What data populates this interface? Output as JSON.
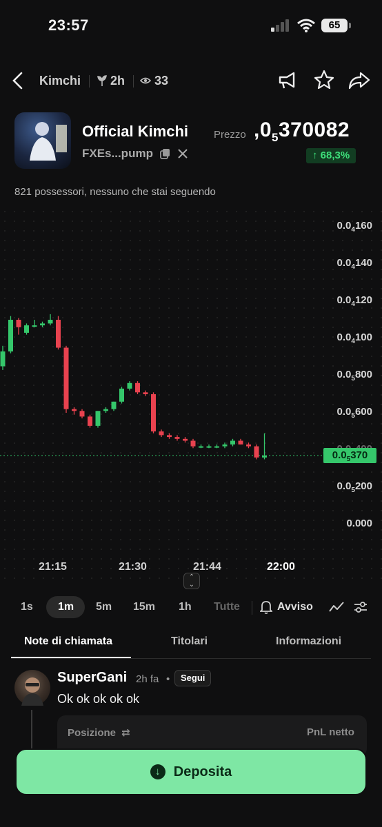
{
  "status_bar": {
    "time": "23:57",
    "battery": "65"
  },
  "header": {
    "name": "Kimchi",
    "age": "2h",
    "viewers": "33"
  },
  "token": {
    "name": "Official Kimchi",
    "address": "FXEs...pump",
    "price_label": "Prezzo",
    "price_prefix": ",0",
    "price_sub": "5",
    "price_digits": "370082",
    "change": "↑ 68,3%",
    "holders_text": "821 possessori, nessuno che stai seguendo"
  },
  "chart": {
    "y_labels": [
      {
        "lead": "0.0",
        "sub": "4",
        "tail": "160"
      },
      {
        "lead": "0.0",
        "sub": "4",
        "tail": "140"
      },
      {
        "lead": "0.0",
        "sub": "4",
        "tail": "120"
      },
      {
        "lead": "0.0",
        "sub": "4",
        "tail": "100"
      },
      {
        "lead": "0.0",
        "sub": "5",
        "tail": "800"
      },
      {
        "lead": "0.0",
        "sub": "5",
        "tail": "600"
      },
      {
        "lead": "0.0",
        "sub": "5",
        "tail": "400"
      },
      {
        "lead": "0.0",
        "sub": "5",
        "tail": "200"
      },
      {
        "lead": "0.000",
        "sub": "",
        "tail": ""
      }
    ],
    "current": {
      "lead": "0.0",
      "sub": "5",
      "tail": "370"
    },
    "x_labels": [
      "21:15",
      "21:30",
      "21:44",
      "22:00"
    ],
    "up_color": "#35c76b",
    "down_color": "#e8424f"
  },
  "chart_data": {
    "type": "candlestick",
    "x_ticks": [
      "21:15",
      "21:30",
      "21:44",
      "22:00"
    ],
    "candles": [
      {
        "o": 8.5e-06,
        "h": 9.6e-06,
        "l": 8.3e-06,
        "c": 9.3e-06
      },
      {
        "o": 9.3e-06,
        "h": 1.12e-05,
        "l": 9.2e-06,
        "c": 1.1e-05
      },
      {
        "o": 1.1e-05,
        "h": 1.11e-05,
        "l": 1.02e-05,
        "c": 1.06e-05
      },
      {
        "o": 1.03e-05,
        "h": 1.08e-05,
        "l": 1.02e-05,
        "c": 1.07e-05
      },
      {
        "o": 1.07e-05,
        "h": 1.1e-05,
        "l": 1.06e-05,
        "c": 1.07e-05
      },
      {
        "o": 1.07e-05,
        "h": 1.09e-05,
        "l": 1.06e-05,
        "c": 1.08e-05
      },
      {
        "o": 1.08e-05,
        "h": 1.13e-05,
        "l": 1.07e-05,
        "c": 1.1e-05
      },
      {
        "o": 1.1e-05,
        "h": 1.12e-05,
        "l": 9.4e-06,
        "c": 9.5e-06
      },
      {
        "o": 9.5e-06,
        "h": 9.6e-06,
        "l": 6e-06,
        "c": 6.2e-06
      },
      {
        "o": 6.2e-06,
        "h": 6.3e-06,
        "l": 5.9e-06,
        "c": 6.1e-06
      },
      {
        "o": 6.1e-06,
        "h": 6.2e-06,
        "l": 5.7e-06,
        "c": 5.8e-06
      },
      {
        "o": 5.8e-06,
        "h": 5.9e-06,
        "l": 5.2e-06,
        "c": 5.3e-06
      },
      {
        "o": 5.3e-06,
        "h": 6.1e-06,
        "l": 5.2e-06,
        "c": 6.1e-06
      },
      {
        "o": 6.1e-06,
        "h": 6.3e-06,
        "l": 6e-06,
        "c": 6.2e-06
      },
      {
        "o": 6.2e-06,
        "h": 6.6e-06,
        "l": 6.1e-06,
        "c": 6.6e-06
      },
      {
        "o": 6.6e-06,
        "h": 7.4e-06,
        "l": 6.5e-06,
        "c": 7.3e-06
      },
      {
        "o": 7.3e-06,
        "h": 7.7e-06,
        "l": 7.2e-06,
        "c": 7.6e-06
      },
      {
        "o": 7.6e-06,
        "h": 7.7e-06,
        "l": 7e-06,
        "c": 7.1e-06
      },
      {
        "o": 7.1e-06,
        "h": 7.2e-06,
        "l": 6.9e-06,
        "c": 7e-06
      },
      {
        "o": 7e-06,
        "h": 7.1e-06,
        "l": 4.9e-06,
        "c": 5e-06
      },
      {
        "o": 5e-06,
        "h": 5.1e-06,
        "l": 4.7e-06,
        "c": 4.8e-06
      },
      {
        "o": 4.8e-06,
        "h": 4.9e-06,
        "l": 4.6e-06,
        "c": 4.7e-06
      },
      {
        "o": 4.7e-06,
        "h": 4.8e-06,
        "l": 4.5e-06,
        "c": 4.6e-06
      },
      {
        "o": 4.6e-06,
        "h": 4.7e-06,
        "l": 4.4e-06,
        "c": 4.5e-06
      },
      {
        "o": 4.5e-06,
        "h": 4.6e-06,
        "l": 4.1e-06,
        "c": 4.2e-06
      },
      {
        "o": 4.2e-06,
        "h": 4.3e-06,
        "l": 4.1e-06,
        "c": 4.2e-06
      },
      {
        "o": 4.2e-06,
        "h": 4.3e-06,
        "l": 4.1e-06,
        "c": 4.2e-06
      },
      {
        "o": 4.2e-06,
        "h": 4.3e-06,
        "l": 4.1e-06,
        "c": 4.2e-06
      },
      {
        "o": 4.2e-06,
        "h": 4.4e-06,
        "l": 4.1e-06,
        "c": 4.3e-06
      },
      {
        "o": 4.3e-06,
        "h": 4.6e-06,
        "l": 4.2e-06,
        "c": 4.5e-06
      },
      {
        "o": 4.5e-06,
        "h": 4.6e-06,
        "l": 4.3e-06,
        "c": 4.3e-06
      },
      {
        "o": 4.3e-06,
        "h": 4.4e-06,
        "l": 4.1e-06,
        "c": 4.2e-06
      },
      {
        "o": 4.2e-06,
        "h": 4.3e-06,
        "l": 3.5e-06,
        "c": 3.6e-06
      },
      {
        "o": 3.6e-06,
        "h": 4.9e-06,
        "l": 3.5e-06,
        "c": 3.7e-06
      }
    ],
    "current_price": "0.0₅370",
    "ylim": [
      0,
      1.6e-05
    ]
  },
  "timeframes": [
    "1s",
    "1m",
    "5m",
    "15m",
    "1h",
    "Tutte"
  ],
  "alert_label": "Avviso",
  "tabs": [
    "Note di chiamata",
    "Titolari",
    "Informazioni"
  ],
  "post": {
    "user": "SuperGani",
    "ago": "2h fa",
    "dot": "•",
    "follow": "Segui",
    "message": "Ok ok ok ok ok",
    "position_label": "Posizione",
    "pnl_label": "PnL netto"
  },
  "deposit_label": "Deposita"
}
